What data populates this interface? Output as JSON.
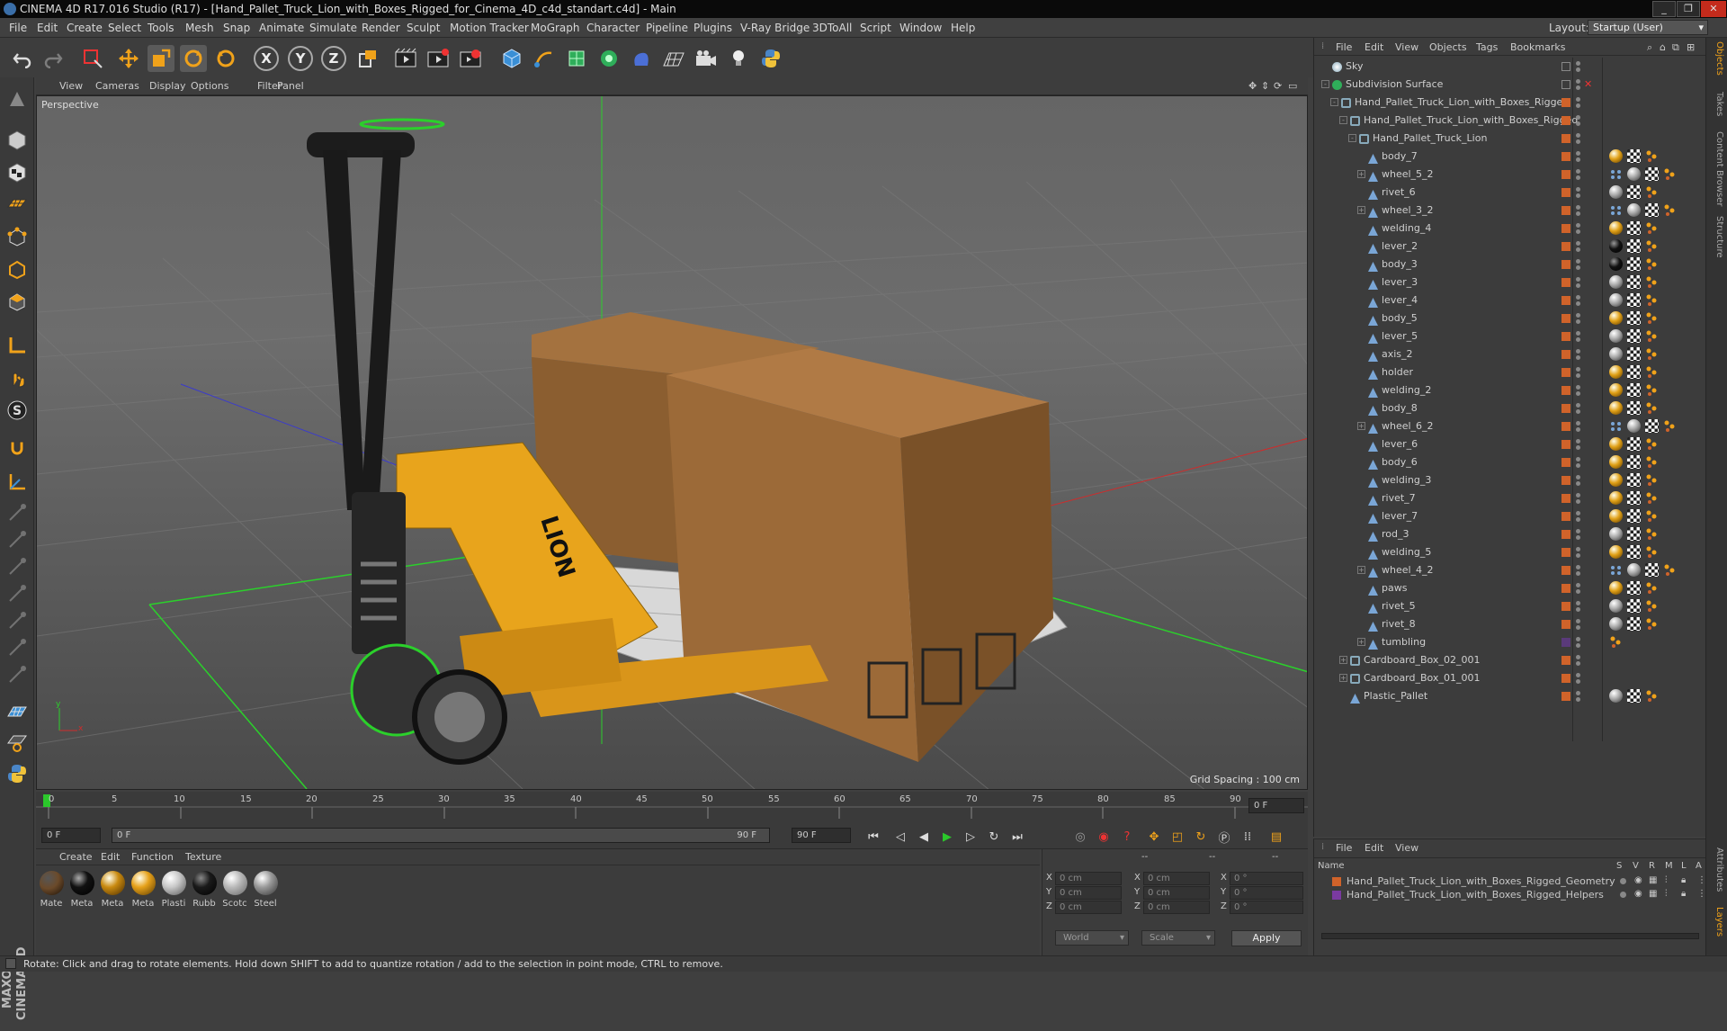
{
  "window": {
    "title": "CINEMA 4D R17.016 Studio (R17) - [Hand_Pallet_Truck_Lion_with_Boxes_Rigged_for_Cinema_4D_c4d_standart.c4d] - Main",
    "minimize": "_",
    "maximize": "❐",
    "close": "✕"
  },
  "menu": [
    "File",
    "Edit",
    "Create",
    "Select",
    "Tools",
    "Mesh",
    "Snap",
    "Animate",
    "Simulate",
    "Render",
    "Sculpt",
    "Motion Tracker",
    "MoGraph",
    "Character",
    "Pipeline",
    "Plugins",
    "V-Ray Bridge",
    "3DToAll",
    "Script",
    "Window",
    "Help"
  ],
  "layout": {
    "label": "Layout:",
    "value": "Startup (User)"
  },
  "toolbar": {
    "x_label": "X",
    "y_label": "Y",
    "z_label": "Z"
  },
  "viewport": {
    "menu": [
      "View",
      "Cameras",
      "Display",
      "Options",
      "Filter",
      "Panel"
    ],
    "label": "Perspective",
    "grid_spacing": "Grid Spacing : 100 cm",
    "axis_x": "x",
    "axis_y": "y",
    "box_text": "LION"
  },
  "timeline": {
    "ticks": [
      "0",
      "5",
      "10",
      "15",
      "20",
      "25",
      "30",
      "35",
      "40",
      "45",
      "50",
      "55",
      "60",
      "65",
      "70",
      "75",
      "80",
      "85",
      "90"
    ],
    "frame_field": "0 F"
  },
  "playback": {
    "start_field": "0 F",
    "range_start": "0 F",
    "range_end": "90 F",
    "end_field": "90 F"
  },
  "materials": {
    "menu": [
      "Create",
      "Edit",
      "Function",
      "Texture"
    ],
    "items": [
      {
        "label": "Mate",
        "color": "#6b4a2a"
      },
      {
        "label": "Meta",
        "color": "#111111"
      },
      {
        "label": "Meta",
        "color": "#c98a10"
      },
      {
        "label": "Meta",
        "color": "#e6a11a"
      },
      {
        "label": "Plasti",
        "color": "#c8c8c8"
      },
      {
        "label": "Rubb",
        "color": "#1a1a1a"
      },
      {
        "label": "Scotc",
        "color": "#b9b9b9"
      },
      {
        "label": "Steel",
        "color": "#9a9a9a"
      }
    ]
  },
  "coords": {
    "header": [
      "--",
      "--",
      "--"
    ],
    "x_label": "X",
    "y_label": "Y",
    "z_label": "Z",
    "h_label": "X",
    "p_label": "Y",
    "b_label": "Z",
    "pos_x": "0 cm",
    "pos_y": "0 cm",
    "pos_z": "0 cm",
    "size_x": "0 cm",
    "size_y": "0 cm",
    "size_z": "0 cm",
    "rot_h": "0 °",
    "rot_p": "0 °",
    "rot_b": "0 °",
    "world": "World",
    "scale": "Scale",
    "apply": "Apply"
  },
  "logo": "MAXON CINEMA 4D",
  "status": "Rotate: Click and drag to rotate elements. Hold down SHIFT to add to quantize rotation / add to the selection in point mode, CTRL to remove.",
  "object_manager": {
    "menu": [
      "File",
      "Edit",
      "View",
      "Objects",
      "Tags",
      "Bookmarks"
    ],
    "objects": [
      {
        "name": "Sky",
        "indent": 0,
        "kind": "sky",
        "tags": []
      },
      {
        "name": "Subdivision Surface",
        "indent": 0,
        "kind": "subd",
        "tags": [],
        "expand": "-"
      },
      {
        "name": "Hand_Pallet_Truck_Lion_with_Boxes_Rigged",
        "indent": 1,
        "kind": "null",
        "tags": [],
        "expand": "-"
      },
      {
        "name": "Hand_Pallet_Truck_Lion_with_Boxes_Rigged",
        "indent": 2,
        "kind": "null",
        "tags": [],
        "expand": "-"
      },
      {
        "name": "Hand_Pallet_Truck_Lion",
        "indent": 3,
        "kind": "null",
        "tags": [],
        "expand": "-"
      },
      {
        "name": "body_7",
        "indent": 4,
        "kind": "bone",
        "tags": [
          "gold",
          "check",
          "dots"
        ]
      },
      {
        "name": "wheel_5_2",
        "indent": 4,
        "kind": "bone",
        "tags": [
          "multi",
          "grey",
          "check",
          "dots"
        ],
        "expand": "+"
      },
      {
        "name": "rivet_6",
        "indent": 4,
        "kind": "bone",
        "tags": [
          "grey",
          "check",
          "dots"
        ]
      },
      {
        "name": "wheel_3_2",
        "indent": 4,
        "kind": "bone",
        "tags": [
          "multi",
          "grey",
          "check",
          "dots"
        ],
        "expand": "+"
      },
      {
        "name": "welding_4",
        "indent": 4,
        "kind": "bone",
        "tags": [
          "gold",
          "check",
          "dots"
        ]
      },
      {
        "name": "lever_2",
        "indent": 4,
        "kind": "bone",
        "tags": [
          "black",
          "check",
          "dots"
        ]
      },
      {
        "name": "body_3",
        "indent": 4,
        "kind": "bone",
        "tags": [
          "black",
          "check",
          "dots"
        ]
      },
      {
        "name": "lever_3",
        "indent": 4,
        "kind": "bone",
        "tags": [
          "grey",
          "check",
          "dots"
        ]
      },
      {
        "name": "lever_4",
        "indent": 4,
        "kind": "bone",
        "tags": [
          "grey",
          "check",
          "dots"
        ]
      },
      {
        "name": "body_5",
        "indent": 4,
        "kind": "bone",
        "tags": [
          "gold",
          "check",
          "dots"
        ]
      },
      {
        "name": "lever_5",
        "indent": 4,
        "kind": "bone",
        "tags": [
          "grey",
          "check",
          "dots"
        ]
      },
      {
        "name": "axis_2",
        "indent": 4,
        "kind": "bone",
        "tags": [
          "grey",
          "check",
          "dots"
        ]
      },
      {
        "name": "holder",
        "indent": 4,
        "kind": "bone",
        "tags": [
          "gold",
          "check",
          "dots"
        ]
      },
      {
        "name": "welding_2",
        "indent": 4,
        "kind": "bone",
        "tags": [
          "gold",
          "check",
          "dots"
        ]
      },
      {
        "name": "body_8",
        "indent": 4,
        "kind": "bone",
        "tags": [
          "gold",
          "check",
          "dots"
        ]
      },
      {
        "name": "wheel_6_2",
        "indent": 4,
        "kind": "bone",
        "tags": [
          "multi",
          "grey",
          "check",
          "dots"
        ],
        "expand": "+"
      },
      {
        "name": "lever_6",
        "indent": 4,
        "kind": "bone",
        "tags": [
          "gold",
          "check",
          "dots"
        ]
      },
      {
        "name": "body_6",
        "indent": 4,
        "kind": "bone",
        "tags": [
          "gold",
          "check",
          "dots"
        ]
      },
      {
        "name": "welding_3",
        "indent": 4,
        "kind": "bone",
        "tags": [
          "gold",
          "check",
          "dots"
        ]
      },
      {
        "name": "rivet_7",
        "indent": 4,
        "kind": "bone",
        "tags": [
          "gold",
          "check",
          "dots"
        ]
      },
      {
        "name": "lever_7",
        "indent": 4,
        "kind": "bone",
        "tags": [
          "gold",
          "check",
          "dots"
        ]
      },
      {
        "name": "rod_3",
        "indent": 4,
        "kind": "bone",
        "tags": [
          "grey",
          "check",
          "dots"
        ]
      },
      {
        "name": "welding_5",
        "indent": 4,
        "kind": "bone",
        "tags": [
          "gold",
          "check",
          "dots"
        ]
      },
      {
        "name": "wheel_4_2",
        "indent": 4,
        "kind": "bone",
        "tags": [
          "multi",
          "grey",
          "check",
          "dots"
        ],
        "expand": "+"
      },
      {
        "name": "paws",
        "indent": 4,
        "kind": "bone",
        "tags": [
          "gold",
          "check",
          "dots"
        ]
      },
      {
        "name": "rivet_5",
        "indent": 4,
        "kind": "bone",
        "tags": [
          "grey",
          "check",
          "dots"
        ]
      },
      {
        "name": "rivet_8",
        "indent": 4,
        "kind": "bone",
        "tags": [
          "grey",
          "check",
          "dots"
        ]
      },
      {
        "name": "tumbling",
        "indent": 4,
        "kind": "bone",
        "tags": [
          "dots"
        ],
        "expand": "+",
        "layer": "#5a3a7a"
      },
      {
        "name": "Cardboard_Box_02_001",
        "indent": 2,
        "kind": "null",
        "tags": [],
        "expand": "+"
      },
      {
        "name": "Cardboard_Box_01_001",
        "indent": 2,
        "kind": "null",
        "tags": [],
        "expand": "+"
      },
      {
        "name": "Plastic_Pallet",
        "indent": 2,
        "kind": "bone",
        "tags": [
          "grey",
          "check",
          "dots"
        ]
      }
    ]
  },
  "layer_manager": {
    "menu": [
      "File",
      "Edit",
      "View"
    ],
    "name_header": "Name",
    "col_headers": [
      "S",
      "V",
      "R",
      "M",
      "L",
      "A"
    ],
    "layers": [
      {
        "name": "Hand_Pallet_Truck_Lion_with_Boxes_Rigged_Geometry",
        "color": "#d0632a"
      },
      {
        "name": "Hand_Pallet_Truck_Lion_with_Boxes_Rigged_Helpers",
        "color": "#7a3aa0"
      }
    ]
  },
  "side_tabs": [
    "Objects",
    "Takes",
    "Content Browser",
    "Structure"
  ],
  "side_tabs_bottom": [
    "Attributes",
    "Layers"
  ],
  "colors": {
    "accent_orange": "#d0632a",
    "gold": "#e0a016",
    "timeline_green": "#28c828"
  }
}
